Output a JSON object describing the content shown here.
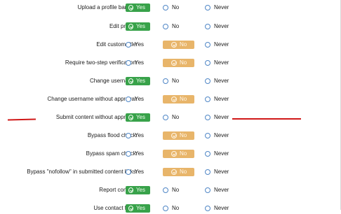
{
  "options": {
    "yes": "Yes",
    "no": "No",
    "never": "Never"
  },
  "colors": {
    "selected_yes": "#38a24a",
    "selected_no": "#e8b56a",
    "radio": "#4f86c6",
    "annotation": "#d01818"
  },
  "rows": [
    {
      "label": "Upload a profile banner:",
      "selected": "yes"
    },
    {
      "label": "Edit profile:",
      "selected": "yes"
    },
    {
      "label": "Edit custom title:",
      "selected": "no"
    },
    {
      "label": "Require two-step verification:",
      "selected": "no"
    },
    {
      "label": "Change username:",
      "selected": "yes"
    },
    {
      "label": "Change username without approval:",
      "selected": "no"
    },
    {
      "label": "Submit content without approval:",
      "selected": "yes"
    },
    {
      "label": "Bypass flood check:",
      "selected": "no"
    },
    {
      "label": "Bypass spam check:",
      "selected": "no"
    },
    {
      "label": "Bypass \"nofollow\" in submitted content links:",
      "selected": "no"
    },
    {
      "label": "Report content:",
      "selected": "yes"
    },
    {
      "label": "Use contact form:",
      "selected": "yes"
    }
  ]
}
